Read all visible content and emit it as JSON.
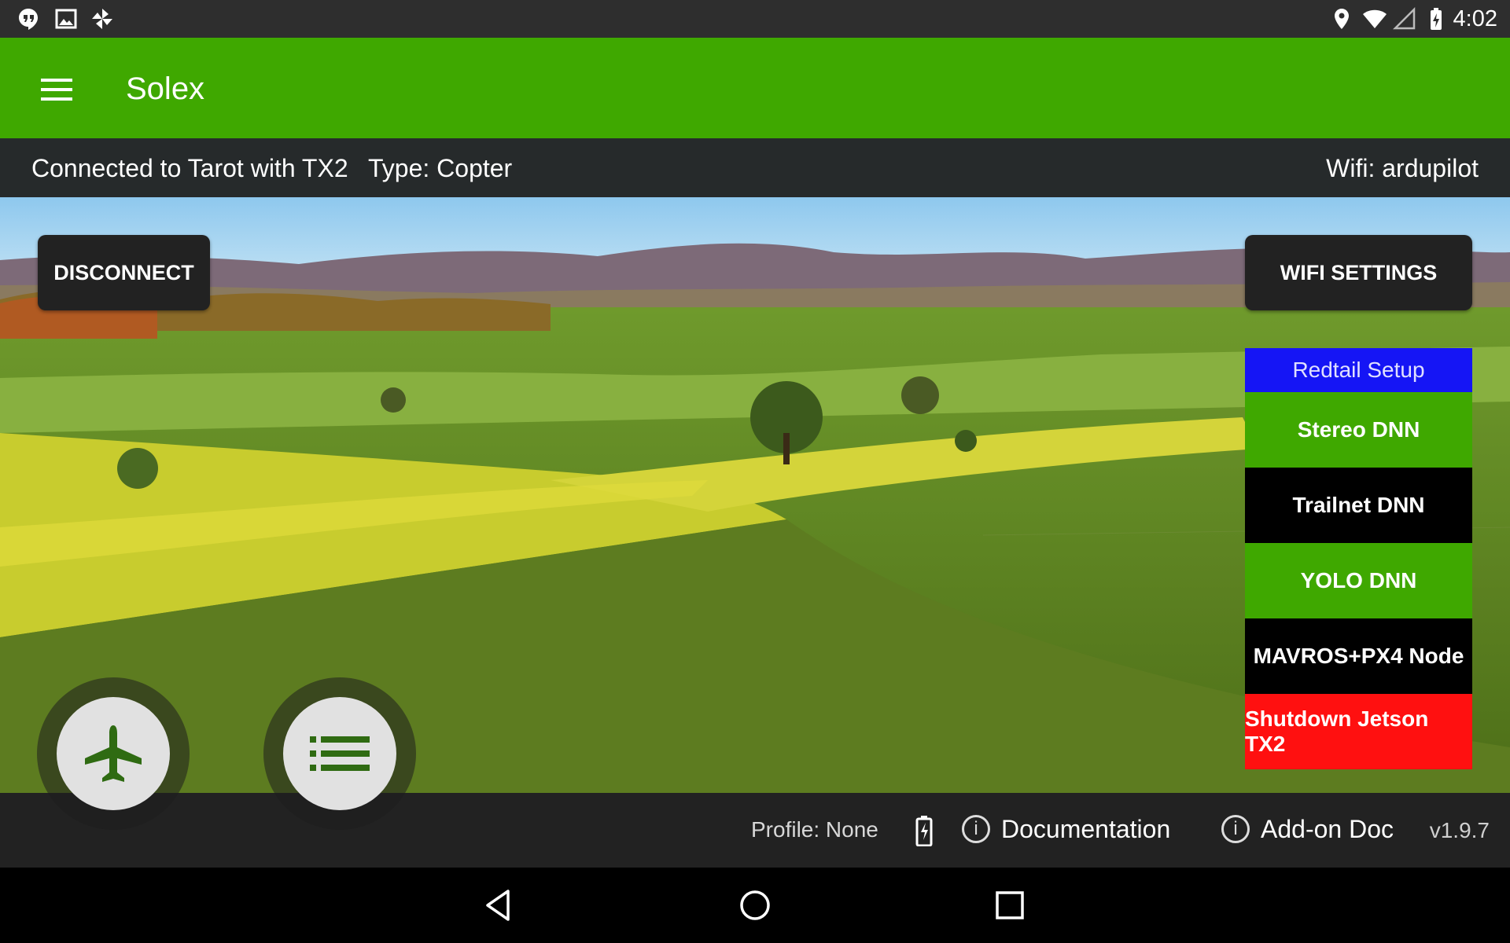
{
  "status_bar": {
    "time": "4:02",
    "left_icons": [
      "hangouts-icon",
      "image-icon",
      "pinwheel-icon"
    ],
    "right_icons": [
      "location-icon",
      "wifi-icon",
      "cell-signal-icon",
      "battery-charging-icon"
    ]
  },
  "app_bar": {
    "title": "Solex",
    "menu_icon": "hamburger-menu-icon",
    "color": "#3fa800"
  },
  "info_bar": {
    "connection": "Connected to Tarot with TX2",
    "type": "Type: Copter",
    "wifi": "Wifi: ardupilot"
  },
  "buttons": {
    "disconnect": "DISCONNECT",
    "wifi_settings": "WIFI SETTINGS"
  },
  "redtail_panel": {
    "header": "Redtail Setup",
    "items": [
      {
        "label": "Stereo DNN",
        "color": "#3fa800"
      },
      {
        "label": "Trailnet DNN",
        "color": "#000000"
      },
      {
        "label": "YOLO DNN",
        "color": "#3fa800"
      },
      {
        "label": "MAVROS+PX4 Node",
        "color": "#000000"
      },
      {
        "label": "Shutdown Jetson TX2",
        "color": "#ff1010"
      }
    ]
  },
  "bottom_bar": {
    "profile": "Profile: None",
    "documentation": "Documentation",
    "addon_doc": "Add-on Doc",
    "version": "v1.9.7"
  },
  "fabs": [
    "airplane-icon",
    "list-icon"
  ],
  "nav_bar": [
    "back-icon",
    "home-icon",
    "recents-icon"
  ]
}
